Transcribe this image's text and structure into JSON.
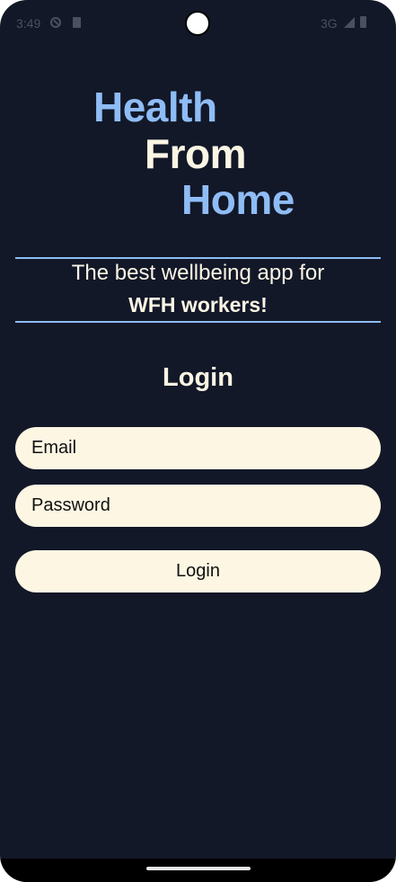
{
  "status_bar": {
    "time": "3:49",
    "network": "3G",
    "icons": [
      "dnd-icon",
      "sim-icon",
      "signal-icon",
      "battery-icon"
    ]
  },
  "logo": {
    "line1": "Health",
    "line2": "From",
    "line3": "Home"
  },
  "tagline": {
    "line1": "The best wellbeing app for",
    "line2": "WFH workers!"
  },
  "login": {
    "title": "Login",
    "email_placeholder": "Email",
    "password_placeholder": "Password",
    "button_label": "Login"
  },
  "colors": {
    "background": "#121828",
    "accent": "#8fbcf5",
    "cream": "#fdf6e3"
  }
}
